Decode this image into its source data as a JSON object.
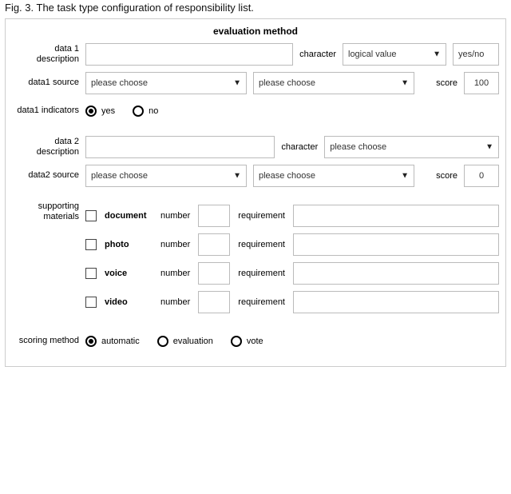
{
  "caption": "Fig. 3. The task type configuration of responsibility list.",
  "panel_title": "evaluation method",
  "labels": {
    "data1_desc": "data 1 description",
    "character": "character",
    "logical_value": "logical value",
    "yesno": "yes/no",
    "data1_source": "data1 source",
    "please_choose": "please choose",
    "score": "score",
    "score1_value": "100",
    "data1_indicators": "data1 indicators",
    "yes": "yes",
    "no": "no",
    "data2_desc": "data 2 description",
    "data2_source": "data2 source",
    "score2_value": "0",
    "supporting_materials": "supporting materials",
    "number": "number",
    "requirement": "requirement",
    "scoring_method": "scoring method",
    "automatic": "automatic",
    "evaluation": "evaluation",
    "vote": "vote"
  },
  "materials": [
    {
      "type": "document"
    },
    {
      "type": "photo"
    },
    {
      "type": "voice"
    },
    {
      "type": "video"
    }
  ]
}
